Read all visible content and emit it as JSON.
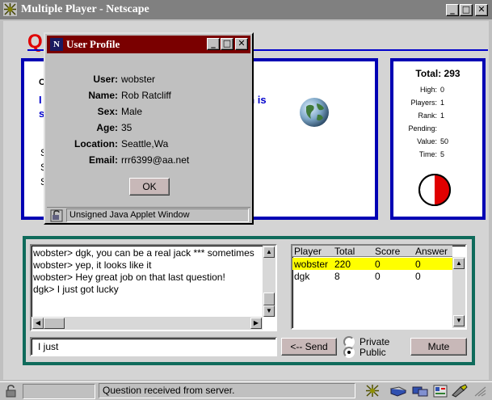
{
  "window": {
    "title": "Multiple Player - Netscape"
  },
  "header": {
    "logo_letter": "Q"
  },
  "question": {
    "label_prefix": "C",
    "line1_start": "I",
    "line1_end": "ch is",
    "line2_start": "s",
    "body_markers": [
      "S",
      "S",
      "S"
    ]
  },
  "score": {
    "total_label": "Total:",
    "total_value": "293",
    "rows": [
      {
        "label": "High:",
        "value": "0"
      },
      {
        "label": "Players:",
        "value": "1"
      },
      {
        "label": "Rank:",
        "value": "1"
      },
      {
        "label": "Pending:",
        "value": ""
      },
      {
        "label": "Value:",
        "value": "50"
      },
      {
        "label": "Time:",
        "value": "5"
      }
    ],
    "timer_fraction": 0.5,
    "timer_color": "#e00000"
  },
  "chat": {
    "lines": [
      "wobster> dgk, you can be a real jack *** sometimes",
      "wobster> yep, it looks like it",
      "wobster> Hey great job on that last question!",
      "dgk> I just got lucky"
    ],
    "input_value": "I just",
    "send_label": "<-- Send",
    "private_label": "Private",
    "public_label": "Public",
    "mute_label": "Mute"
  },
  "players": {
    "headers": [
      "Player",
      "Total",
      "Score",
      "Answer"
    ],
    "rows": [
      {
        "player": "wobster",
        "total": "220",
        "score": "0",
        "answer": "0",
        "highlight": true
      },
      {
        "player": "dgk",
        "total": "8",
        "score": "0",
        "answer": "0",
        "highlight": false
      }
    ],
    "highlight_color": "#ffff00"
  },
  "profile": {
    "title": "User Profile",
    "icon_letter": "N",
    "user_label": "User:",
    "user_value": "wobster",
    "name_label": "Name:",
    "name_value": "Rob Ratcliff",
    "sex_label": "Sex:",
    "sex_value": "Male",
    "age_label": "Age:",
    "age_value": "35",
    "location_label": "Location:",
    "location_value": "Seattle,Wa",
    "email_label": "Email:",
    "email_value": "rrr6399@aa.net",
    "ok_label": "OK",
    "footer_text": "Unsigned Java Applet Window"
  },
  "status": {
    "text": "Question received from server."
  },
  "colors": {
    "accent_blue": "#0000b4",
    "teal": "#0f6b5b",
    "profile_title": "#7a0000"
  }
}
